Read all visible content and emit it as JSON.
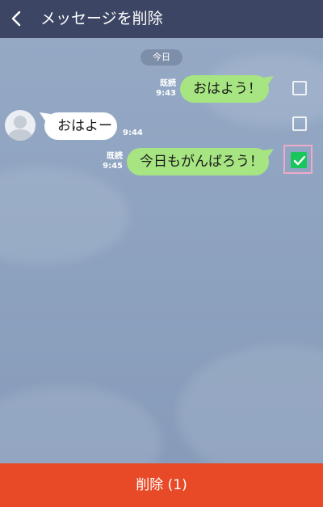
{
  "header": {
    "back_icon": "chevron-left-icon",
    "title": "メッセージを削除"
  },
  "chat": {
    "date_label": "今日",
    "messages": [
      {
        "sender": "me",
        "text": "おはよう！",
        "read_label": "既読",
        "time": "9:43",
        "selected": false
      },
      {
        "sender": "friend",
        "avatar_icon": "default-avatar-icon",
        "text": "おはよー",
        "time": "9:44",
        "selected": false
      },
      {
        "sender": "me",
        "text": "今日もがんばろう！",
        "read_label": "既読",
        "time": "9:45",
        "selected": true
      }
    ]
  },
  "footer": {
    "delete_label": "削除 (1)"
  },
  "colors": {
    "header_bg": "#3c4563",
    "chat_bg": "#8da2bf",
    "sent_bubble": "#a6e582",
    "received_bubble": "#ffffff",
    "checkbox_checked": "#19c65c",
    "selection_highlight": "#f1a9c8",
    "delete_bar": "#e84a28"
  }
}
